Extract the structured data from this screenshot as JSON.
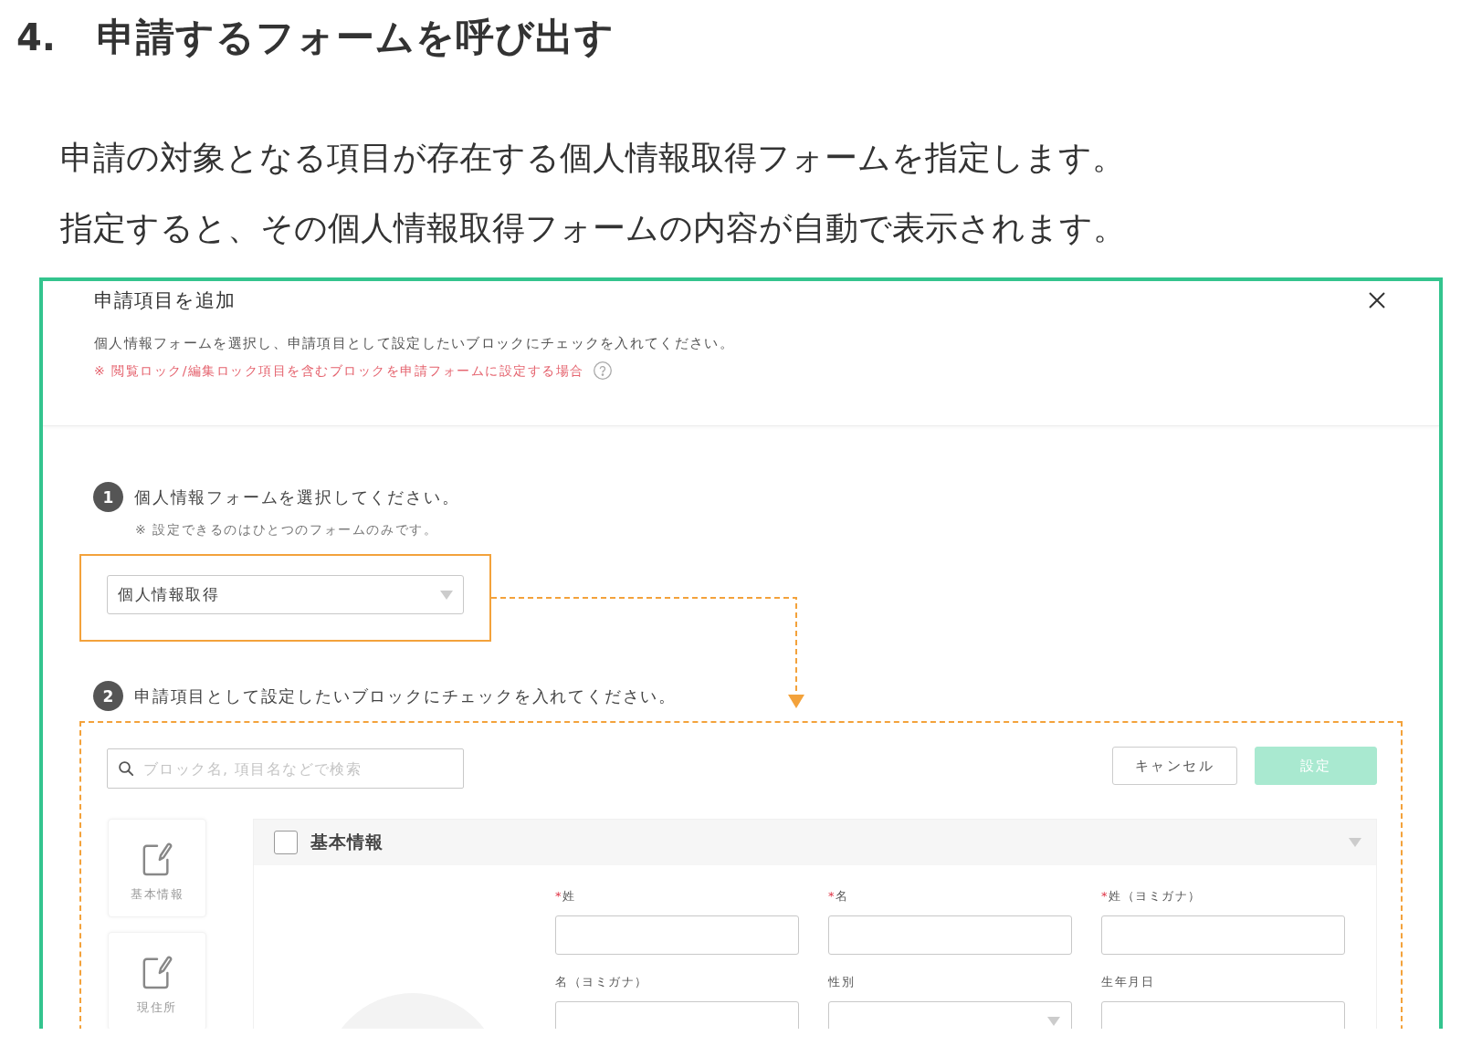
{
  "heading": {
    "number": "4.",
    "title": "申請するフォームを呼び出す"
  },
  "paragraphs": [
    "申請の対象となる項目が存在する個人情報取得フォームを指定します。",
    "指定すると、その個人情報取得フォームの内容が自動で表示されます。"
  ],
  "dialog": {
    "title": "申請項目を追加",
    "description": "個人情報フォームを選択し、申請項目として設定したいブロックにチェックを入れてください。",
    "note": "※ 閲覧ロック/編集ロック項目を含むブロックを申請フォームに設定する場合",
    "step_1": {
      "number": "1",
      "label": "個人情報フォームを選択してください。",
      "hint": "※ 設定できるのはひとつのフォームのみです。",
      "highlighted": true,
      "select": {
        "value": "個人情報取得"
      }
    },
    "step_2": {
      "number": "2",
      "label": "申請項目として設定したいブロックにチェックを入れてください。",
      "highlighted": true,
      "search": {
        "placeholder": "ブロック名, 項目名などで検索"
      },
      "buttons": [
        {
          "label": "キャンセル",
          "kind": "secondary",
          "disabled": false
        },
        {
          "label": "設定",
          "kind": "primary",
          "disabled": true
        }
      ],
      "sidebar": {
        "items": [
          {
            "label": "基本情報"
          },
          {
            "label": "現住所"
          }
        ]
      },
      "block": {
        "title": "基本情報",
        "checked": false,
        "expanded": true,
        "fields": [
          {
            "label": "姓",
            "required_mark": "*",
            "kind": "text"
          },
          {
            "label": "名",
            "required_mark": "*",
            "kind": "text"
          },
          {
            "label": "姓（ヨミガナ）",
            "required_mark": "*",
            "kind": "text"
          },
          {
            "label": "名（ヨミガナ）",
            "kind": "text"
          },
          {
            "label": "性別",
            "kind": "select"
          },
          {
            "label": "生年月日",
            "kind": "text"
          }
        ]
      }
    }
  }
}
